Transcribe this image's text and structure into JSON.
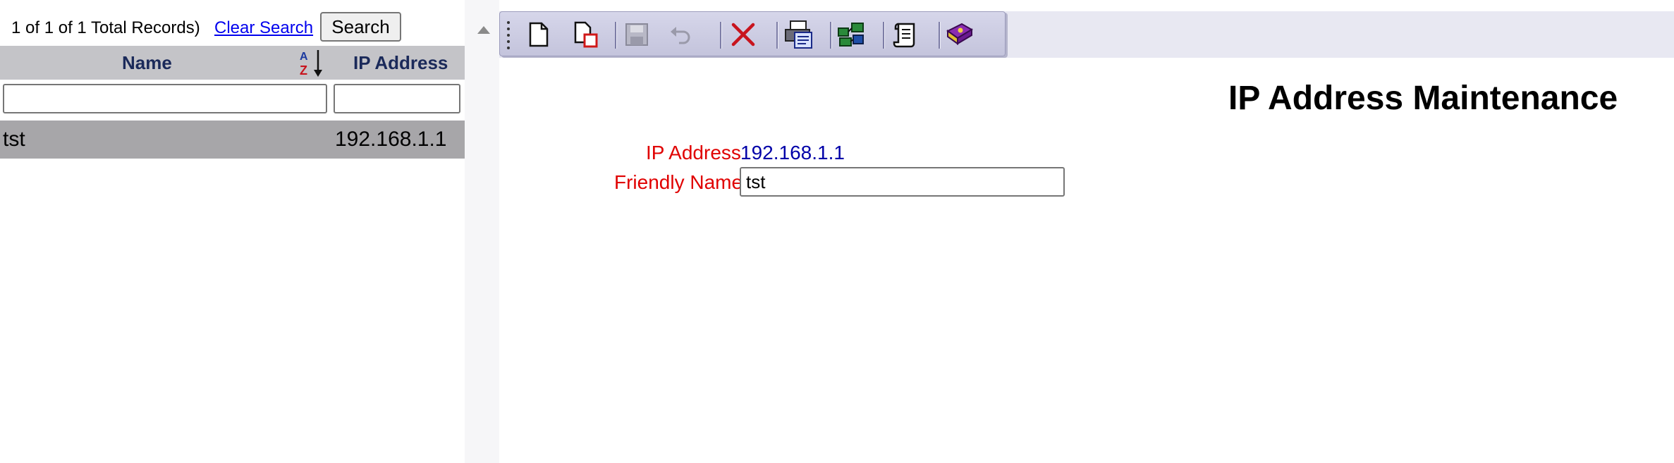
{
  "search_bar": {
    "records_text": "1 of 1 of 1 Total Records)",
    "clear_link": "Clear Search",
    "search_button": "Search"
  },
  "grid": {
    "columns": [
      "Name",
      "IP Address"
    ],
    "sort_icon": "sort-az-descending-icon",
    "filters": {
      "name": "",
      "ip": ""
    },
    "rows": [
      {
        "name": "tst",
        "ip": "192.168.1.1"
      }
    ]
  },
  "toolbar": {
    "buttons": [
      {
        "icon": "new-document-icon",
        "enabled": true
      },
      {
        "icon": "copy-document-icon",
        "enabled": true
      },
      {
        "icon": "save-icon",
        "enabled": false
      },
      {
        "icon": "undo-icon",
        "enabled": false
      },
      {
        "icon": "delete-icon",
        "enabled": true
      },
      {
        "icon": "print-icon",
        "enabled": true
      },
      {
        "icon": "network-icon",
        "enabled": true
      },
      {
        "icon": "scroll-icon",
        "enabled": true
      },
      {
        "icon": "help-book-icon",
        "enabled": true
      }
    ]
  },
  "form": {
    "title": "IP Address Maintenance",
    "ip_label": "IP Address",
    "ip_value": "192.168.1.1",
    "friendly_label": "Friendly Name",
    "friendly_value": "tst"
  },
  "colors": {
    "header_bg": "#c4c4c8",
    "header_text": "#1b2a5a",
    "selected_row_bg": "#a7a6a9",
    "label_red": "#e00000",
    "value_blue": "#0000a8",
    "link_blue": "#0000ee"
  }
}
